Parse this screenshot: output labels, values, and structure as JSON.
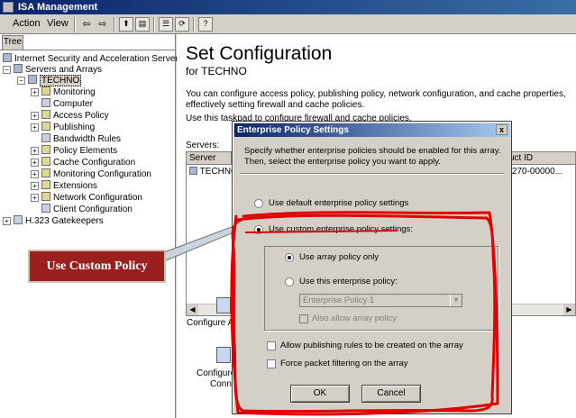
{
  "app": {
    "title": "ISA Management"
  },
  "menu": {
    "action": "Action",
    "view": "View"
  },
  "toolbar_icons": [
    "back-arrow-icon",
    "forward-arrow-icon",
    "up-folder-icon",
    "show-hide-tree-icon",
    "properties-icon",
    "refresh-icon",
    "help-icon"
  ],
  "tree": {
    "tab": "Tree",
    "nodes": [
      {
        "label": "Internet Security and Acceleration Server"
      },
      {
        "label": "Servers and Arrays"
      },
      {
        "label": "TECHNO"
      },
      {
        "label": "Monitoring"
      },
      {
        "label": "Computer"
      },
      {
        "label": "Access Policy"
      },
      {
        "label": "Publishing"
      },
      {
        "label": "Bandwidth Rules"
      },
      {
        "label": "Policy Elements"
      },
      {
        "label": "Cache Configuration"
      },
      {
        "label": "Monitoring Configuration"
      },
      {
        "label": "Extensions"
      },
      {
        "label": "Network Configuration"
      },
      {
        "label": "Client Configuration"
      },
      {
        "label": "H.323 Gatekeepers"
      }
    ]
  },
  "main": {
    "title": "Set Configuration",
    "subtitle": "for TECHNO",
    "description": "You can configure access policy, publishing policy, network configuration, and cache properties, effectively setting firewall and cache policies.",
    "use_text": "Use this taskpad to configure firewall and cache policies.",
    "servers_label": "Servers:",
    "columns": [
      "Server",
      "uct ID"
    ],
    "row": {
      "server": "TECHNO",
      "product_id": "5-270-00000..."
    },
    "tasks": [
      "Configure A",
      "Configure",
      "Conn"
    ]
  },
  "callout": {
    "text": "Use Custom Policy"
  },
  "dialog": {
    "title": "Enterprise Policy Settings",
    "close": "x",
    "intro": "Specify whether enterprise policies should be enabled for this array. Then, select the enterprise policy you want to apply.",
    "opt_default": "Use default enterprise policy settings",
    "opt_custom": "Use custom enterprise policy settings:",
    "opt_array_only": "Use array policy only",
    "opt_this_policy": "Use this enterprise policy:",
    "policy_selected": "Enterprise Policy 1",
    "also_allow": "Also allow array policy",
    "allow_publishing": "Allow publishing rules to be created on the array",
    "force_filtering": "Force packet filtering on the array",
    "ok": "OK",
    "cancel": "Cancel"
  },
  "colors": {
    "title_bar": "#0a246a",
    "callout_bg": "#9a1f1f",
    "annotation_red": "#e00000"
  }
}
